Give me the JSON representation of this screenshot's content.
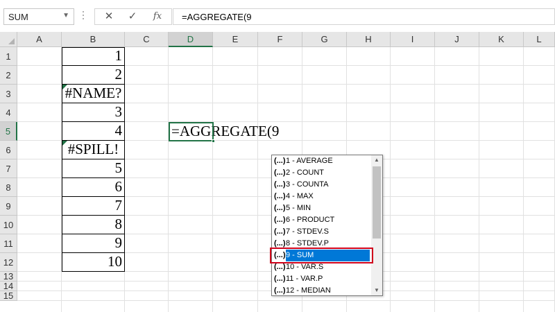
{
  "formula_bar": {
    "name_box": "SUM",
    "cancel_icon": "✕",
    "enter_icon": "✓",
    "fx_label": "fx",
    "formula": "=AGGREGATE(9"
  },
  "columns": [
    "A",
    "B",
    "C",
    "D",
    "E",
    "F",
    "G",
    "H",
    "I",
    "J",
    "K",
    "L"
  ],
  "selected_column": "D",
  "rows": [
    "1",
    "2",
    "3",
    "4",
    "5",
    "6",
    "7",
    "8",
    "9",
    "10",
    "11",
    "12",
    "13",
    "14",
    "15"
  ],
  "selected_row": "5",
  "column_b": [
    "1",
    "2",
    "#NAME?",
    "3",
    "4",
    "#SPILL!",
    "5",
    "6",
    "7",
    "8",
    "9",
    "10"
  ],
  "active_cell_text": "=AGGREGATE(9",
  "autocomplete": {
    "items": [
      {
        "icon": "(...)",
        "label": "1 - AVERAGE"
      },
      {
        "icon": "(...)",
        "label": "2 - COUNT"
      },
      {
        "icon": "(...)",
        "label": "3 - COUNTA"
      },
      {
        "icon": "(...)",
        "label": "4 - MAX"
      },
      {
        "icon": "(...)",
        "label": "5 - MIN"
      },
      {
        "icon": "(...)",
        "label": "6 - PRODUCT"
      },
      {
        "icon": "(...)",
        "label": "7 - STDEV.S"
      },
      {
        "icon": "(...)",
        "label": "8 - STDEV.P"
      },
      {
        "icon": "(...)",
        "label": "9 - SUM"
      },
      {
        "icon": "(...)",
        "label": "10 - VAR.S"
      },
      {
        "icon": "(...)",
        "label": "11 - VAR.P"
      },
      {
        "icon": "(...)",
        "label": "12 - MEDIAN"
      }
    ],
    "selected_label": "9 - SUM"
  },
  "colors": {
    "accent": "#217346",
    "highlight": "#0078d7",
    "annotation_box": "#d0021b"
  }
}
